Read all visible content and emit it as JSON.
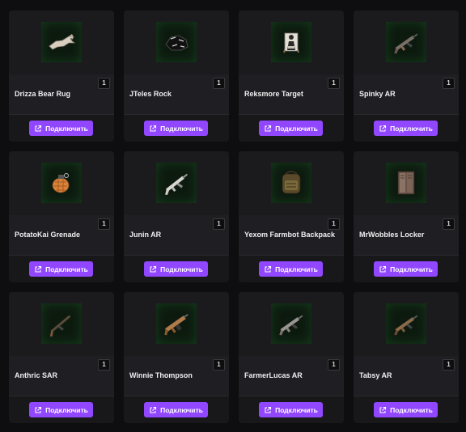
{
  "button_label": "Подключить",
  "button_icon": "external-link-icon",
  "accent_color": "#9147ff",
  "items": [
    {
      "name": "Drizza Bear Rug",
      "qty": "1",
      "icon": "bear-rug-icon"
    },
    {
      "name": "JTeles Rock",
      "qty": "1",
      "icon": "rock-icon"
    },
    {
      "name": "Reksmore Target",
      "qty": "1",
      "icon": "target-icon"
    },
    {
      "name": "Spinky AR",
      "qty": "1",
      "icon": "assault-rifle-icon"
    },
    {
      "name": "PotatoKai Grenade",
      "qty": "1",
      "icon": "grenade-icon"
    },
    {
      "name": "Junin AR",
      "qty": "1",
      "icon": "assault-rifle-icon"
    },
    {
      "name": "Yexom Farmbot Backpack",
      "qty": "1",
      "icon": "backpack-icon"
    },
    {
      "name": "MrWobbles Locker",
      "qty": "1",
      "icon": "locker-icon"
    },
    {
      "name": "Anthric SAR",
      "qty": "1",
      "icon": "semi-auto-rifle-icon"
    },
    {
      "name": "Winnie Thompson",
      "qty": "1",
      "icon": "thompson-icon"
    },
    {
      "name": "FarmerLucas AR",
      "qty": "1",
      "icon": "assault-rifle-icon"
    },
    {
      "name": "Tabsy AR",
      "qty": "1",
      "icon": "assault-rifle-icon"
    }
  ]
}
